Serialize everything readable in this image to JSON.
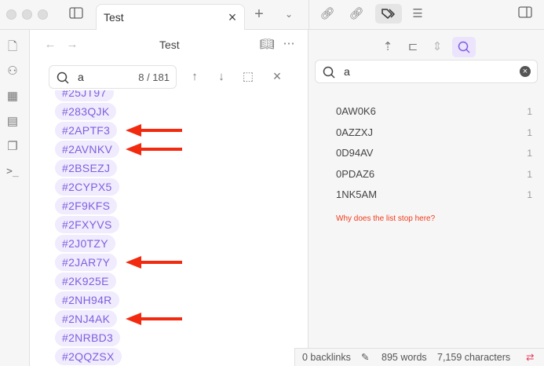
{
  "tab": {
    "title": "Test"
  },
  "editor": {
    "title": "Test",
    "search": {
      "query": "a",
      "count": "8 / 181"
    },
    "tags": [
      "#25JT97",
      "#283QJK",
      "#2APTF3",
      "#2AVNKV",
      "#2BSEZJ",
      "#2CYPX5",
      "#2F9KFS",
      "#2FXYVS",
      "#2J0TZY",
      "#2JAR7Y",
      "#2K925E",
      "#2NH94R",
      "#2NJ4AK",
      "#2NRBD3",
      "#2QQZSX"
    ],
    "arrow_colors": "#f22a10"
  },
  "right_panel": {
    "search": {
      "query": "a"
    },
    "tags": [
      {
        "name": "0AW0K6",
        "count": "1"
      },
      {
        "name": "0AZZXJ",
        "count": "1"
      },
      {
        "name": "0D94AV",
        "count": "1"
      },
      {
        "name": "0PDAZ6",
        "count": "1"
      },
      {
        "name": "1NK5AM",
        "count": "1"
      }
    ],
    "note": "Why does the list stop here?"
  },
  "status": {
    "backlinks": "0 backlinks",
    "words": "895 words",
    "characters": "7,159 characters"
  },
  "colors": {
    "accent": "#7d5fe0",
    "pill_bg": "#f0ebfd",
    "note": "#f23a1a"
  }
}
